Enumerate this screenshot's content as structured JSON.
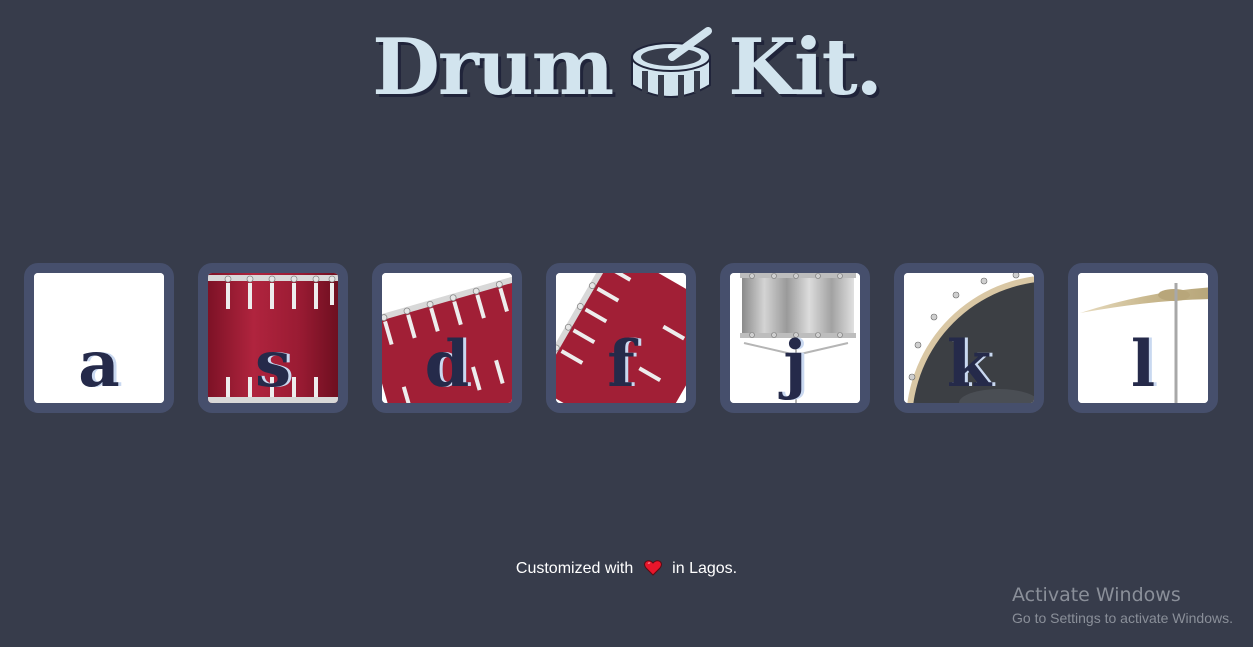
{
  "header": {
    "title_left": "Drum",
    "title_right": "Kit",
    "title_dot": ".",
    "logo_icon": "drum-icon"
  },
  "drums": [
    {
      "key": "a",
      "instrument_icon": "blank-pad-icon"
    },
    {
      "key": "s",
      "instrument_icon": "red-tom-drum-icon"
    },
    {
      "key": "d",
      "instrument_icon": "red-tilted-tom-icon"
    },
    {
      "key": "f",
      "instrument_icon": "red-tilted-tom-icon"
    },
    {
      "key": "j",
      "instrument_icon": "snare-drum-icon"
    },
    {
      "key": "k",
      "instrument_icon": "bass-drum-icon"
    },
    {
      "key": "l",
      "instrument_icon": "cymbal-icon"
    }
  ],
  "footer": {
    "prefix": "Customized with",
    "suffix": "in Lagos.",
    "heart_icon": "heart-icon"
  },
  "watermark": {
    "title": "Activate Windows",
    "subtitle": "Go to Settings to activate Windows."
  },
  "colors": {
    "background": "#373c4b",
    "title": "#d2e4ee",
    "button_border": "#464f6c",
    "key_letter": "#252a4a",
    "drum_red": "#a11f36",
    "heart": "#e8162b"
  }
}
